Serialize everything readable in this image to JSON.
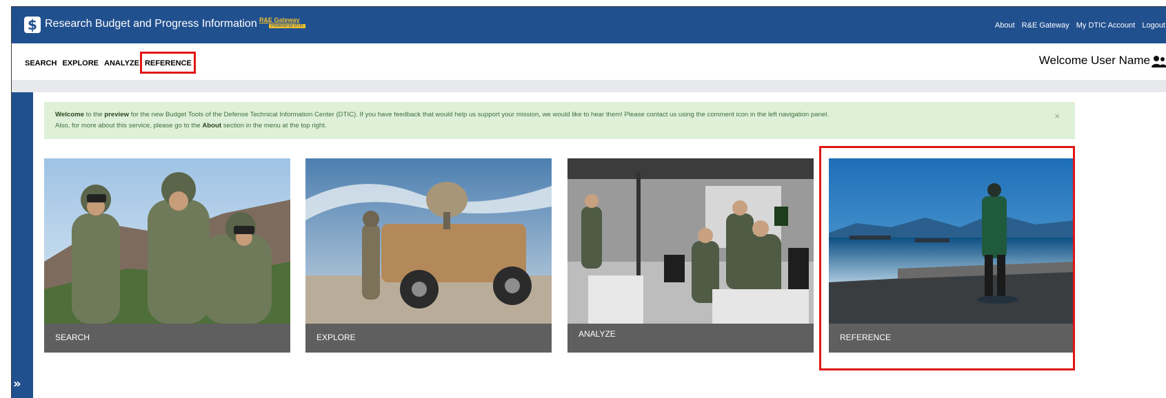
{
  "header": {
    "app_title": "Research Budget and Progress Information",
    "gateway_badge": "R&E Gateway",
    "gateway_powered": "Powered by DTIC",
    "links": [
      "About",
      "R&E Gateway",
      "My DTIC Account",
      "Logout"
    ]
  },
  "nav": {
    "items": [
      "SEARCH",
      "EXPLORE",
      "ANALYZE",
      "REFERENCE"
    ],
    "welcome": "Welcome  User Name"
  },
  "alert": {
    "line1_welcome": "Welcome",
    "line1_a": " to the ",
    "line1_preview": "preview",
    "line1_b": " for the new Budget Tools of the Defense Technical Information Center (DTIC). If you have feedback that would help us support your mission, we would like to hear them! Please contact us using the comment icon in the left navigation panel.",
    "line2_a": "Also, for more about this service, please go to the ",
    "line2_about": "About",
    "line2_b": " section in the menu at the top right.",
    "close": "×"
  },
  "cards": [
    {
      "label": "SEARCH"
    },
    {
      "label": "EXPLORE"
    },
    {
      "label": "ANALYZE"
    },
    {
      "label": "REFERENCE"
    }
  ],
  "sidebar": {
    "expand": "»"
  },
  "icons": {
    "logo": "dollar-logo-icon",
    "user": "user-icon",
    "close": "close-icon",
    "expand": "double-chevron-right-icon"
  },
  "colors": {
    "brand_blue": "#21508f",
    "alert_bg": "#dff0d8",
    "highlight_red": "#e01515",
    "card_label_bg": "#5f5f5f"
  }
}
